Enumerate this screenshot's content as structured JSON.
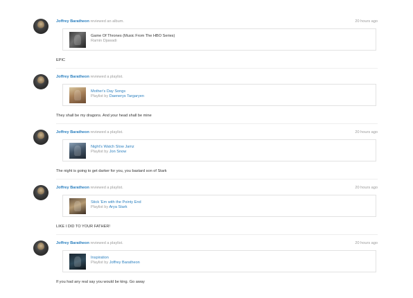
{
  "feed": {
    "entries": [
      {
        "user": "Joffrey Baratheon",
        "action": "reviewed an album.",
        "time": "20 hours ago",
        "item_title": "Game Of Thrones (Music From The HBO Series)",
        "item_sub_prefix": "",
        "item_owner": "Ramin Djawadi",
        "comment": "EPIC"
      },
      {
        "user": "Joffrey Baratheon",
        "action": "reviewed a playlist.",
        "time": "",
        "item_title": "Mother's Day Songs",
        "item_sub_prefix": "Playlist by ",
        "item_owner": "Daenerys Targaryen",
        "comment": "They shall be my dragons. And your head shall be mine"
      },
      {
        "user": "Joffrey Baratheon",
        "action": "reviewed a playlist.",
        "time": "20 hours ago",
        "item_title": "Night's Watch Slow Jamz",
        "item_sub_prefix": "Playlist by ",
        "item_owner": "Jon Snow",
        "comment": "The night is going to get darker for you, you bastard son of Stark"
      },
      {
        "user": "Joffrey Baratheon",
        "action": "reviewed a playlist.",
        "time": "20 hours ago",
        "item_title": "Stick 'Em with the Pointy End",
        "item_sub_prefix": "Playlist by ",
        "item_owner": "Arya Stark",
        "comment": "LIKE I DID TO YOUR FATHER!"
      },
      {
        "user": "Joffrey Baratheon",
        "action": "reviewed a playlist.",
        "time": "20 hours ago",
        "item_title": "Inspiration",
        "item_sub_prefix": "Playlist by ",
        "item_owner": "Joffrey Baratheon",
        "comment": "If you had any real say you would be king. Go away"
      }
    ]
  },
  "colors": {
    "link": "#2a7fbf",
    "muted": "#9a9a9a",
    "text": "#333333",
    "border": "#e2e2e2"
  }
}
